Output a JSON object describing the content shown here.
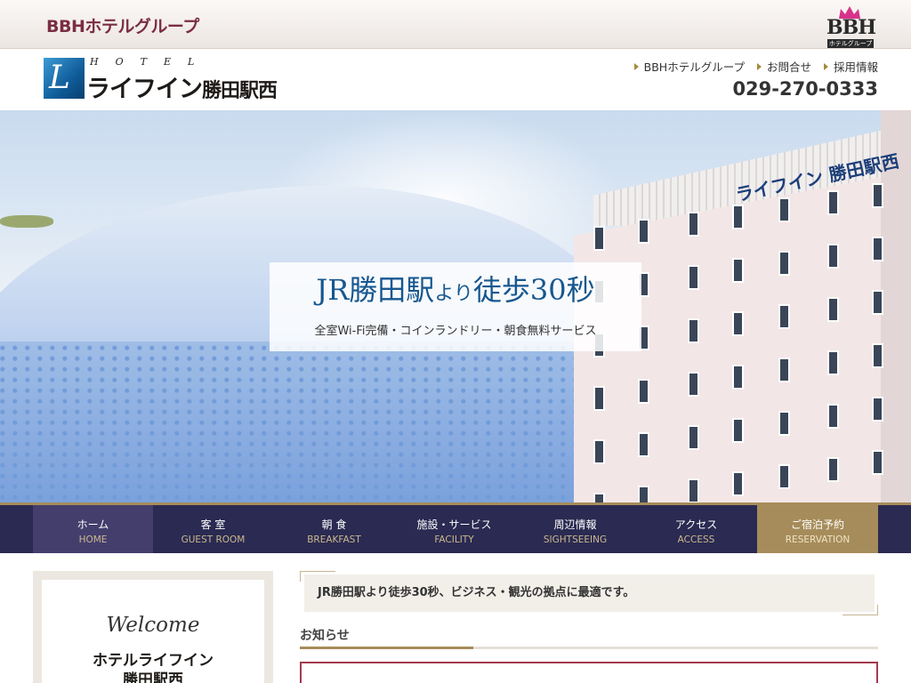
{
  "group_bar": {
    "group_name": "BBHホテルグループ",
    "bbh_logo_text": "BBH",
    "bbh_logo_sub": "ホテルグループ"
  },
  "header": {
    "logo_hotel": "HOTEL",
    "logo_name_main": "ライフイン",
    "logo_name_station": "勝田駅西",
    "links": [
      {
        "label": "BBHホテルグループ"
      },
      {
        "label": "お問合せ"
      },
      {
        "label": "採用情報"
      }
    ],
    "phone": "029-270-0333"
  },
  "hero": {
    "title_a": "JR勝田駅",
    "title_b": "より",
    "title_c": "徒歩30秒",
    "subtitle": "全室Wi-Fi完備・コインランドリー・朝食無料サービス",
    "building_sign": "ライフイン 勝田駅西"
  },
  "nav": [
    {
      "jp": "ホーム",
      "en": "HOME"
    },
    {
      "jp": "客 室",
      "en": "GUEST ROOM"
    },
    {
      "jp": "朝 食",
      "en": "BREAKFAST"
    },
    {
      "jp": "施設・サービス",
      "en": "FACILITY"
    },
    {
      "jp": "周辺情報",
      "en": "SIGHTSEEING"
    },
    {
      "jp": "アクセス",
      "en": "ACCESS"
    },
    {
      "jp": "ご宿泊予約",
      "en": "RESERVATION"
    }
  ],
  "welcome": {
    "script": "Welcome",
    "name_line1": "ホテルライフイン",
    "name_line2": "勝田駅西"
  },
  "tagline": "JR勝田駅より徒歩30秒、ビジネス・観光の拠点に最適です。",
  "news": {
    "heading": "お知らせ"
  },
  "colors": {
    "nav_bg": "#2a2a52",
    "accent_gold": "#a68c5a",
    "brand_maroon": "#7b2d45",
    "title_blue": "#17578f"
  }
}
